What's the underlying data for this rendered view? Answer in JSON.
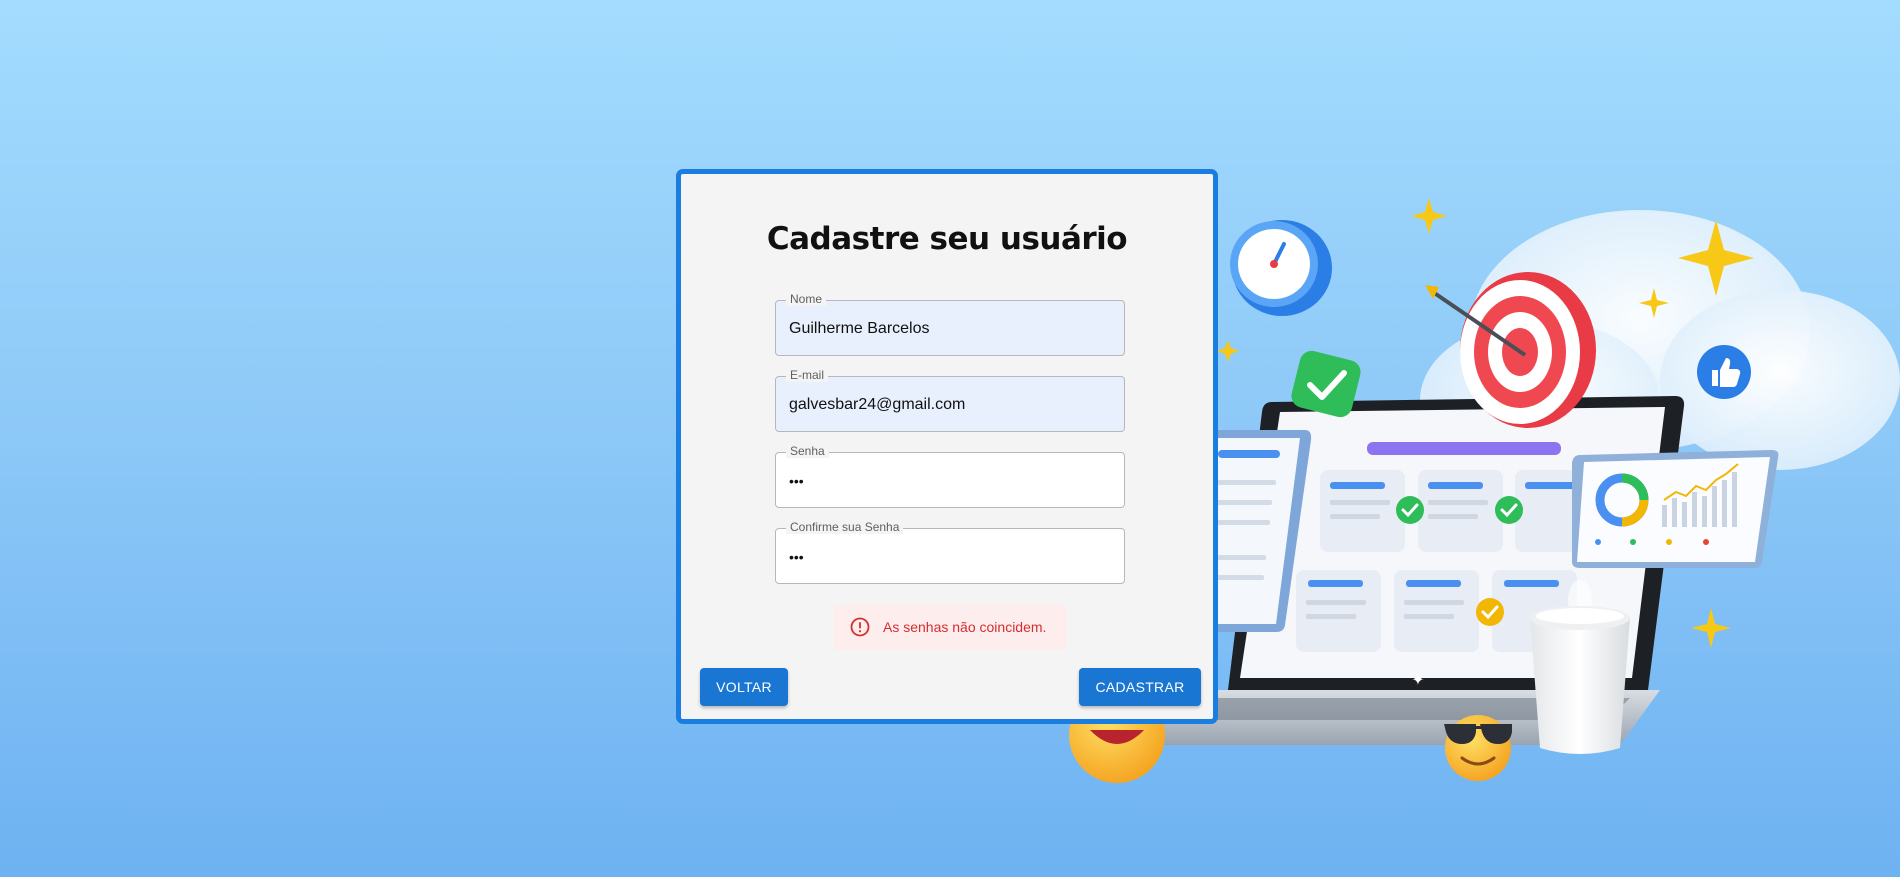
{
  "form": {
    "title": "Cadastre seu usuário",
    "fields": [
      {
        "label": "Nome",
        "value": "Guilherme Barcelos"
      },
      {
        "label": "E-mail",
        "value": "galvesbar24@gmail.com"
      },
      {
        "label": "Senha",
        "value": "•••"
      },
      {
        "label": "Confirme sua Senha",
        "value": "•••"
      }
    ],
    "error_message": "As senhas não coincidem.",
    "back_label": "VOLTAR",
    "submit_label": "CADASTRAR"
  },
  "colors": {
    "accent": "#1976d2",
    "card_border": "#1a7ee0",
    "error": "#d32f2f",
    "error_bg": "#fdeded",
    "autofill_bg": "#e8f0fe"
  },
  "icons": [
    "error-outline-icon",
    "clock-icon",
    "target-icon",
    "check-icon",
    "thumbs-up-icon",
    "sparkle-icon",
    "coffee-cup-icon",
    "sunglasses-emoji-icon"
  ]
}
